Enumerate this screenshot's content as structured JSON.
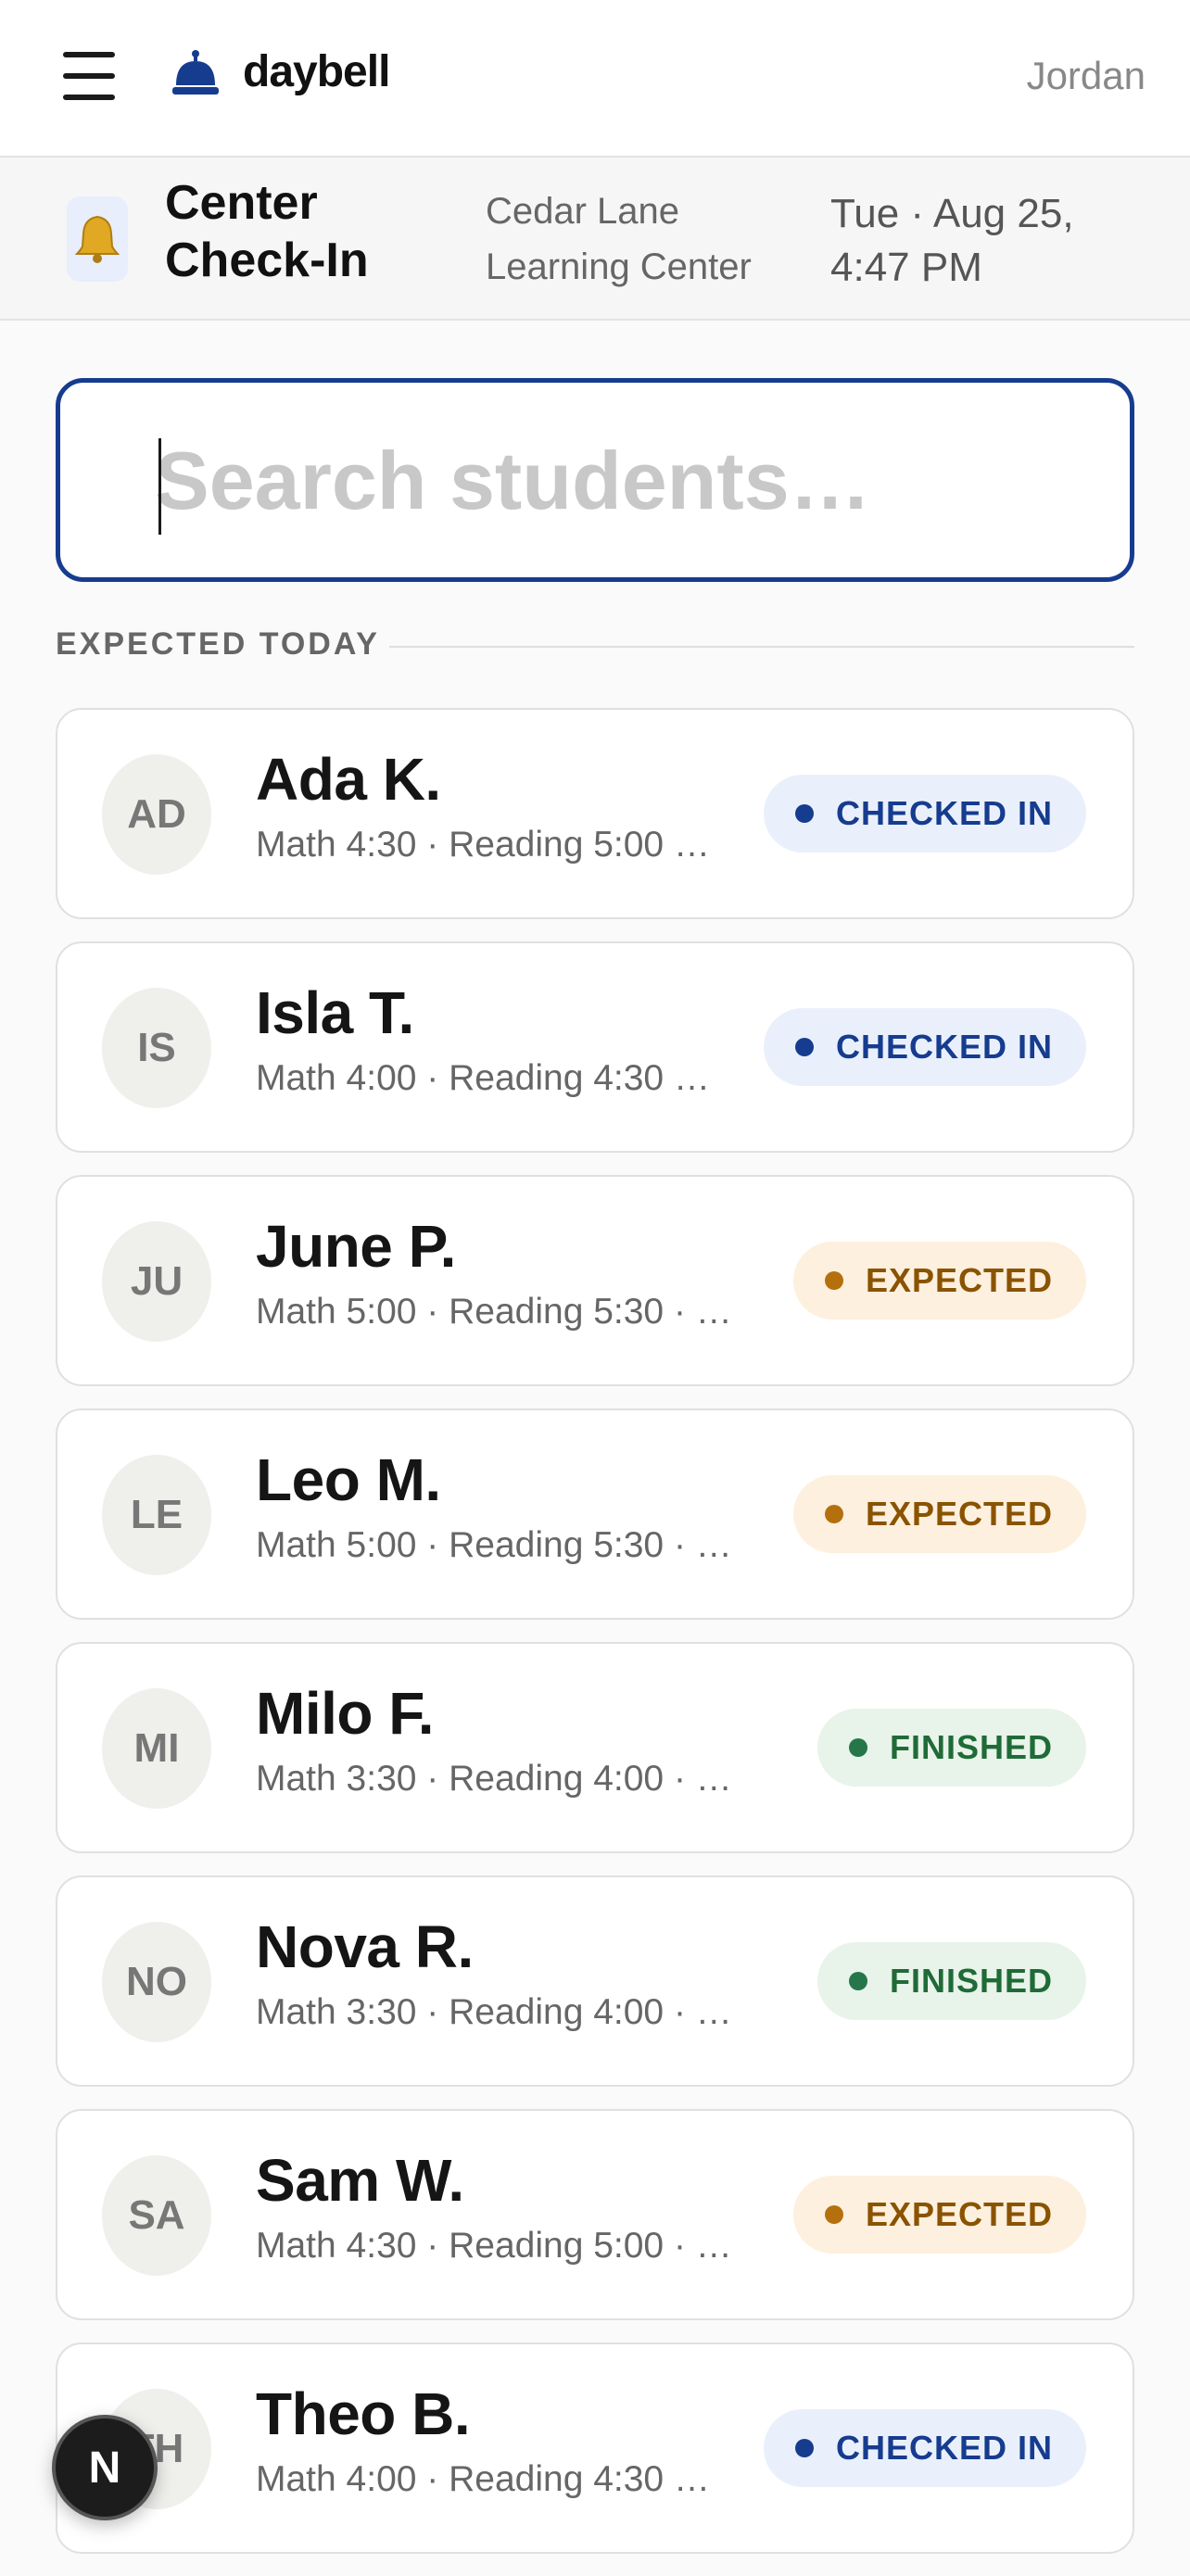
{
  "header": {
    "brand": "daybell",
    "user": "Jordan"
  },
  "context": {
    "title": "Center Check-In",
    "center": "Cedar Lane Learning Center",
    "datetime": "Tue · Aug 25, 4:47 PM"
  },
  "search": {
    "placeholder": "Search students…"
  },
  "section": {
    "label": "EXPECTED TODAY"
  },
  "students": [
    {
      "initials": "AD",
      "name": "Ada K.",
      "classes": "Math 4:30 · Reading 5:00 …",
      "status": "CHECKED IN"
    },
    {
      "initials": "IS",
      "name": "Isla T.",
      "classes": "Math 4:00 · Reading 4:30 …",
      "status": "CHECKED IN"
    },
    {
      "initials": "JU",
      "name": "June P.",
      "classes": "Math 5:00 · Reading 5:30 · …",
      "status": "EXPECTED"
    },
    {
      "initials": "LE",
      "name": "Leo M.",
      "classes": "Math 5:00 · Reading 5:30 · …",
      "status": "EXPECTED"
    },
    {
      "initials": "MI",
      "name": "Milo F.",
      "classes": "Math 3:30 · Reading 4:00 · …",
      "status": "FINISHED"
    },
    {
      "initials": "NO",
      "name": "Nova R.",
      "classes": "Math 3:30 · Reading 4:00 · …",
      "status": "FINISHED"
    },
    {
      "initials": "SA",
      "name": "Sam W.",
      "classes": "Math 4:30 · Reading 5:00 · …",
      "status": "EXPECTED"
    },
    {
      "initials": "TH",
      "name": "Theo B.",
      "classes": "Math 4:00 · Reading 4:30 …",
      "status": "CHECKED IN"
    }
  ],
  "fab": {
    "label": "N"
  },
  "colors": {
    "accent": "#163c8f",
    "checked_in": "#163c8f",
    "expected": "#8a5300",
    "finished": "#1f6b37"
  },
  "icons": {
    "menu": "hamburger-menu-icon",
    "brand": "service-bell-icon",
    "context": "bell-emoji-icon"
  }
}
